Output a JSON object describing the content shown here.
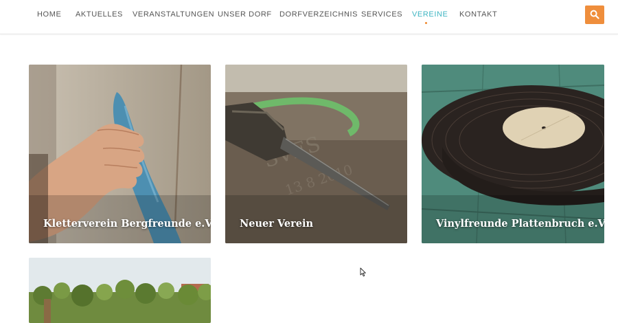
{
  "nav": {
    "items": [
      {
        "label": "HOME"
      },
      {
        "label": "AKTUELLES"
      },
      {
        "label": "VERANSTALTUNGEN"
      },
      {
        "label": "UNSER DORF"
      },
      {
        "label": "DORFVERZEICHNIS"
      },
      {
        "label": "SERVICES"
      },
      {
        "label": "VEREINE"
      },
      {
        "label": "KONTAKT"
      }
    ],
    "active_label": "VEREINE",
    "caret_glyph": "▾"
  },
  "search": {
    "icon": "search-icon"
  },
  "colors": {
    "nav_text": "#555555",
    "nav_active": "#3fb5c2",
    "active_dot": "#ef8a2f",
    "search_button": "#ef8e3c"
  },
  "clubs": [
    {
      "title": "Kletterverein Bergfreunde e.V.",
      "image": "climbing-wall-photo"
    },
    {
      "title": "Neuer Verein",
      "image": "chisel-stone-photo"
    },
    {
      "title": "Vinylfreunde Plattenbruch e.V.",
      "image": "vinyl-record-photo"
    },
    {
      "title": "",
      "image": "village-forest-photo"
    }
  ]
}
